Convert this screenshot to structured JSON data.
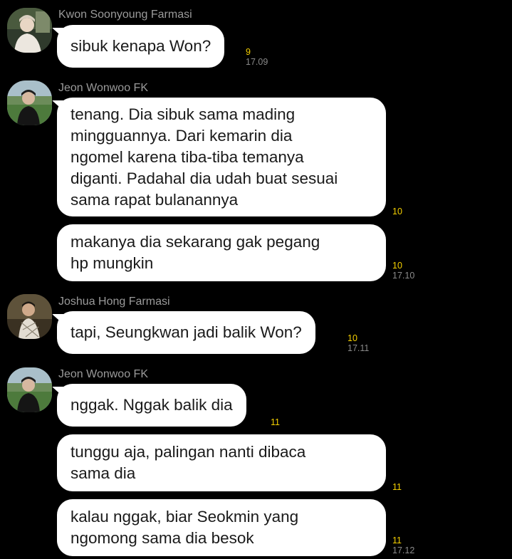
{
  "messages": [
    {
      "sender": "Kwon Soonyoung Farmasi",
      "bubbles": [
        {
          "lines": [
            "sibuk kenapa Won?"
          ],
          "unread": "9",
          "time": "17.09"
        }
      ]
    },
    {
      "sender": "Jeon Wonwoo FK",
      "bubbles": [
        {
          "lines": [
            "tenang. Dia sibuk sama mading",
            "mingguannya. Dari kemarin dia",
            "ngomel karena tiba-tiba temanya",
            "diganti. Padahal dia udah buat sesuai",
            "sama rapat bulanannya"
          ],
          "unread": "10",
          "time": ""
        },
        {
          "lines": [
            "makanya dia sekarang gak pegang",
            "hp mungkin"
          ],
          "unread": "10",
          "time": "17.10"
        }
      ]
    },
    {
      "sender": "Joshua Hong Farmasi",
      "bubbles": [
        {
          "lines": [
            "tapi, Seungkwan jadi balik Won?"
          ],
          "unread": "10",
          "time": "17.11"
        }
      ]
    },
    {
      "sender": "Jeon Wonwoo FK",
      "bubbles": [
        {
          "lines": [
            "nggak. Nggak balik dia"
          ],
          "unread": "11",
          "time": ""
        },
        {
          "lines": [
            "tunggu aja, palingan nanti dibaca",
            "sama dia"
          ],
          "unread": "11",
          "time": ""
        },
        {
          "lines": [
            "kalau nggak, biar Seokmin yang",
            "ngomong sama dia besok"
          ],
          "unread": "11",
          "time": "17.12"
        }
      ]
    }
  ],
  "colors": {
    "background": "#000000",
    "bubble": "#ffffff",
    "unread": "#f5d000",
    "sender": "#9a9a9a",
    "time": "#8a8a8a"
  }
}
